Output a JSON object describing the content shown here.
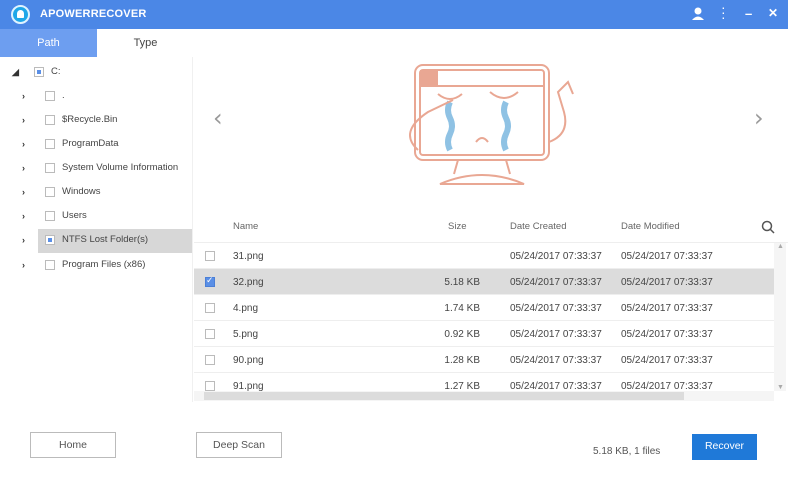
{
  "window": {
    "title": "APOWERRECOVER"
  },
  "tabs": [
    {
      "label": "Path"
    },
    {
      "label": "Type"
    }
  ],
  "tree": {
    "root": {
      "label": "C:"
    },
    "items": [
      {
        "label": "."
      },
      {
        "label": "$Recycle.Bin"
      },
      {
        "label": "ProgramData"
      },
      {
        "label": "System Volume Information"
      },
      {
        "label": "Windows"
      },
      {
        "label": "Users"
      },
      {
        "label": "NTFS Lost Folder(s)"
      },
      {
        "label": "Program Files (x86)"
      }
    ]
  },
  "table": {
    "headers": {
      "name": "Name",
      "size": "Size",
      "created": "Date Created",
      "modified": "Date Modified"
    },
    "rows": [
      {
        "name": "31.png",
        "size": "",
        "created": "05/24/2017 07:33:37",
        "modified": "05/24/2017 07:33:37",
        "checked": false
      },
      {
        "name": "32.png",
        "size": "5.18 KB",
        "created": "05/24/2017 07:33:37",
        "modified": "05/24/2017 07:33:37",
        "checked": true
      },
      {
        "name": "4.png",
        "size": "1.74 KB",
        "created": "05/24/2017 07:33:37",
        "modified": "05/24/2017 07:33:37",
        "checked": false
      },
      {
        "name": "5.png",
        "size": "0.92 KB",
        "created": "05/24/2017 07:33:37",
        "modified": "05/24/2017 07:33:37",
        "checked": false
      },
      {
        "name": "90.png",
        "size": "1.28 KB",
        "created": "05/24/2017 07:33:37",
        "modified": "05/24/2017 07:33:37",
        "checked": false
      },
      {
        "name": "91.png",
        "size": "1.27 KB",
        "created": "05/24/2017 07:33:37",
        "modified": "05/24/2017 07:33:37",
        "checked": false
      }
    ]
  },
  "footer": {
    "home": "Home",
    "deep_scan": "Deep Scan",
    "summary": "5.18 KB, 1 files",
    "recover": "Recover"
  },
  "colors": {
    "accent": "#4b87e6",
    "recover": "#1f79d8",
    "selected_row": "#dcdcdc"
  }
}
